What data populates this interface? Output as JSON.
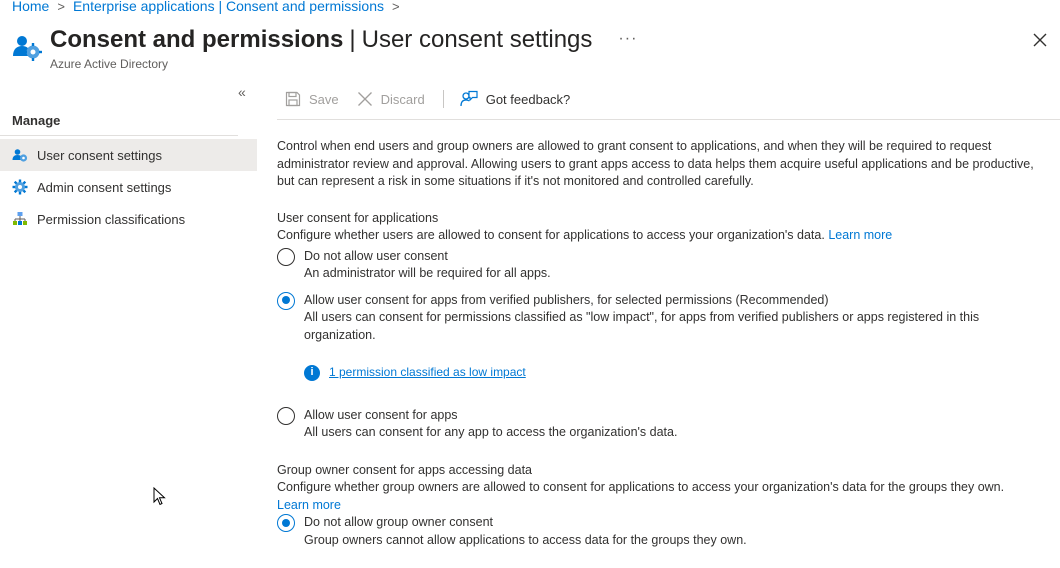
{
  "breadcrumb": {
    "home": "Home",
    "sep": ">",
    "item2": "Enterprise applications | Consent and permissions",
    "trail": ">"
  },
  "header": {
    "title_main": "Consent and permissions",
    "title_sep": "|",
    "title_sub": "User consent settings",
    "more": "···",
    "subtitle": "Azure Active Directory"
  },
  "sidebar": {
    "collapse": "«",
    "section": "Manage",
    "items": [
      {
        "label": "User consent settings"
      },
      {
        "label": "Admin consent settings"
      },
      {
        "label": "Permission classifications"
      }
    ]
  },
  "toolbar": {
    "save": "Save",
    "discard": "Discard",
    "feedback": "Got feedback?"
  },
  "main": {
    "intro": "Control when end users and group owners are allowed to grant consent to applications, and when they will be required to request administrator review and approval. Allowing users to grant apps access to data helps them acquire useful applications and be productive, but can represent a risk in some situations if it's not monitored and controlled carefully.",
    "user_consent": {
      "title": "User consent for applications",
      "desc": "Configure whether users are allowed to consent for applications to access your organization's data.",
      "learn_more": "Learn more",
      "options": [
        {
          "label": "Do not allow user consent",
          "desc": "An administrator will be required for all apps.",
          "checked": false
        },
        {
          "label": "Allow user consent for apps from verified publishers, for selected permissions (Recommended)",
          "desc": "All users can consent for permissions classified as \"low impact\", for apps from verified publishers or apps registered in this organization.",
          "checked": true
        },
        {
          "label": "Allow user consent for apps",
          "desc": "All users can consent for any app to access the organization's data.",
          "checked": false
        }
      ],
      "info_link": "1 permission classified as low impact"
    },
    "group_consent": {
      "title": "Group owner consent for apps accessing data",
      "desc": "Configure whether group owners are allowed to consent for applications to access your organization's data for the groups they own.",
      "learn_more": "Learn more",
      "options": [
        {
          "label": "Do not allow group owner consent",
          "desc": "Group owners cannot allow applications to access data for the groups they own.",
          "checked": true
        }
      ]
    }
  },
  "colors": {
    "accent": "#0078d4",
    "text": "#323130",
    "muted": "#605e5c",
    "disabled": "#a19f9d",
    "active_bg": "#edebe9"
  }
}
